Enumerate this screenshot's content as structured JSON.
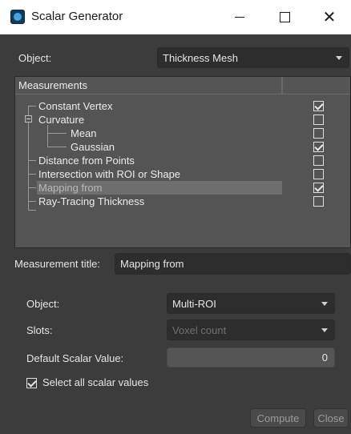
{
  "window": {
    "title": "Scalar Generator"
  },
  "top": {
    "object_label": "Object:",
    "object_value": "Thickness Mesh"
  },
  "tree": {
    "header": "Measurements",
    "items": [
      {
        "label": "Constant Vertex",
        "checked": true,
        "level": 0,
        "selected": false
      },
      {
        "label": "Curvature",
        "checked": false,
        "level": 0,
        "selected": false,
        "expanded": true
      },
      {
        "label": "Mean",
        "checked": false,
        "level": 1,
        "selected": false
      },
      {
        "label": "Gaussian",
        "checked": true,
        "level": 1,
        "selected": false
      },
      {
        "label": "Distance from Points",
        "checked": false,
        "level": 0,
        "selected": false
      },
      {
        "label": "Intersection with ROI or Shape",
        "checked": false,
        "level": 0,
        "selected": false
      },
      {
        "label": "Mapping from",
        "checked": true,
        "level": 0,
        "selected": true
      },
      {
        "label": "Ray-Tracing Thickness",
        "checked": false,
        "level": 0,
        "selected": false
      }
    ]
  },
  "measurement": {
    "title_label": "Measurement title:",
    "title_value": "Mapping from"
  },
  "mapping": {
    "object_label": "Object:",
    "object_value": "Multi-ROI",
    "slots_label": "Slots:",
    "slots_value": "Voxel count",
    "default_label": "Default Scalar Value:",
    "default_value": "0",
    "select_all_label": "Select all scalar values"
  },
  "buttons": {
    "compute": "Compute",
    "close": "Close"
  },
  "icons": [
    "app-icon",
    "minimize-icon",
    "maximize-icon",
    "close-icon",
    "chevron-down-icon",
    "collapse-icon",
    "checkmark-icon"
  ]
}
